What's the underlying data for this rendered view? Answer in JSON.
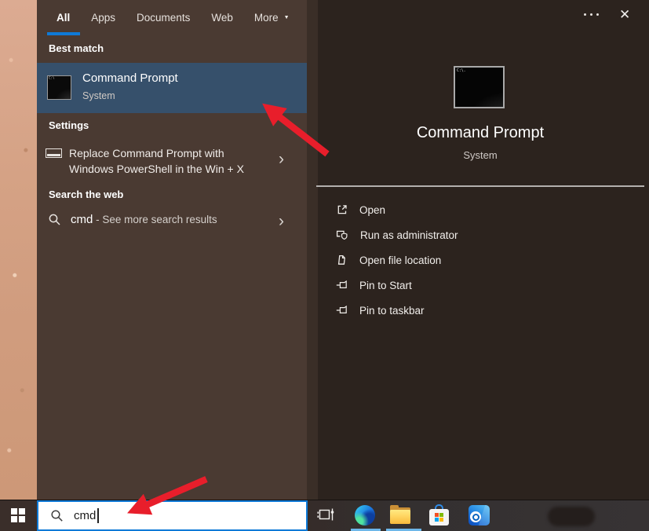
{
  "header": {
    "tabs": [
      {
        "label": "All",
        "active": true
      },
      {
        "label": "Apps",
        "active": false
      },
      {
        "label": "Documents",
        "active": false
      },
      {
        "label": "Web",
        "active": false
      },
      {
        "label": "More",
        "active": false,
        "has_dropdown": true
      }
    ]
  },
  "icons": {
    "dropdown": "▼",
    "close": "✕",
    "chevron": "›"
  },
  "sections": {
    "best_match": {
      "header": "Best match",
      "item": {
        "title": "Command Prompt",
        "subtitle": "System"
      }
    },
    "settings": {
      "header": "Settings",
      "item": {
        "line1": "Replace Command Prompt with",
        "line2": "Windows PowerShell in the Win + X"
      }
    },
    "web": {
      "header": "Search the web",
      "item": {
        "query": "cmd",
        "suffix": " - See more search results"
      }
    }
  },
  "preview": {
    "title": "Command Prompt",
    "subtitle": "System",
    "terminal_prompt": "C:\\.",
    "actions": [
      {
        "label": "Open"
      },
      {
        "label": "Run as administrator"
      },
      {
        "label": "Open file location"
      },
      {
        "label": "Pin to Start"
      },
      {
        "label": "Pin to taskbar"
      }
    ]
  },
  "taskbar": {
    "search_value": "cmd"
  },
  "colors": {
    "accent_blue": "#0f7ad7",
    "highlight_row": "#36506b",
    "arrow_red": "#e81e2b",
    "left_panel": "#4a3a32",
    "right_panel": "#2c231e",
    "running_indicator": "#6db7e9"
  },
  "annotations": {
    "arrow_count": 2,
    "arrow_color": "#e81e2b"
  }
}
